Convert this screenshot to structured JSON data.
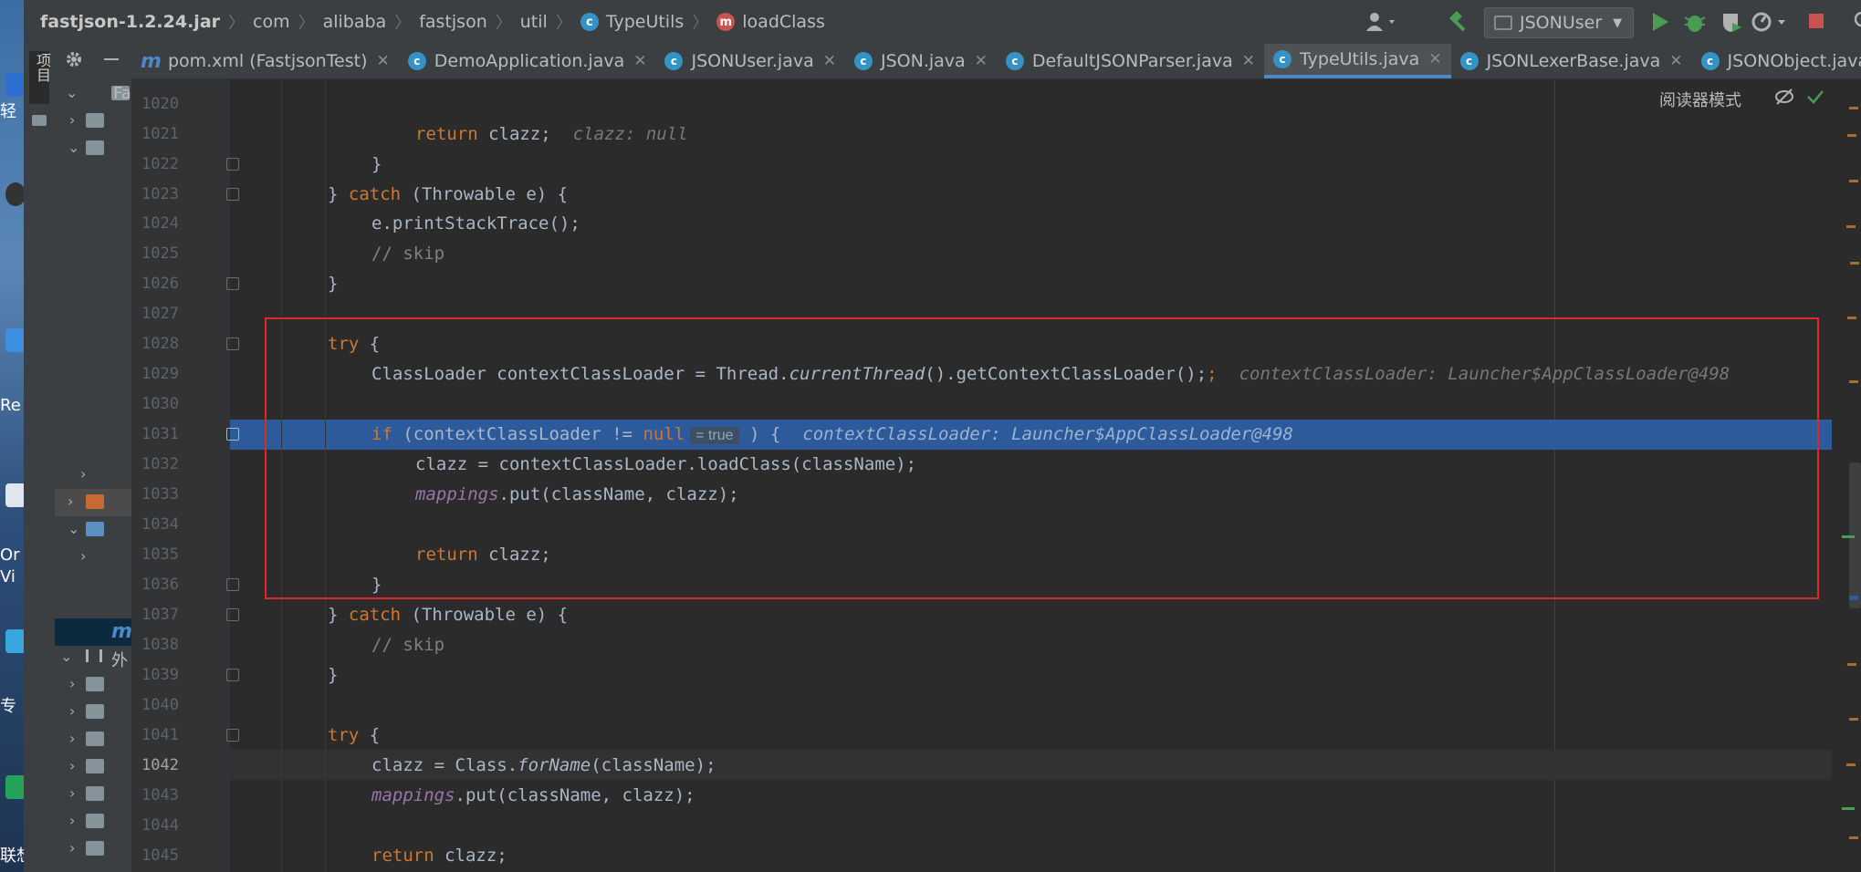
{
  "breadcrumb": {
    "project": "fastjson-1.2.24.jar",
    "parts": [
      "com",
      "alibaba",
      "fastjson",
      "util"
    ],
    "class_name": "TypeUtils",
    "method_name": "loadClass"
  },
  "toolbar": {
    "run_config": "JSONUser",
    "icons": [
      "user-icon",
      "hammer-icon",
      "run-icon",
      "debug-icon",
      "coverage-icon",
      "profile-icon",
      "stop-icon",
      "search-icon"
    ]
  },
  "project_panel": {
    "vertical_label": "项目",
    "labels": [
      "Fa",
      "外"
    ]
  },
  "desktop": {
    "labels": [
      "轻",
      "Re",
      "Or",
      "Vi",
      "专",
      "联想"
    ]
  },
  "tabs": [
    {
      "label": "pom.xml (FastjsonTest)",
      "icon": "maven-icon",
      "active": false
    },
    {
      "label": "DemoApplication.java",
      "icon": "class-icon",
      "active": false
    },
    {
      "label": "JSONUser.java",
      "icon": "class-icon",
      "active": false
    },
    {
      "label": "JSON.java",
      "icon": "class-icon",
      "active": false
    },
    {
      "label": "DefaultJSONParser.java",
      "icon": "class-icon",
      "active": false
    },
    {
      "label": "TypeUtils.java",
      "icon": "class-icon",
      "active": true
    },
    {
      "label": "JSONLexerBase.java",
      "icon": "class-icon",
      "active": false
    },
    {
      "label": "JSONObject.java",
      "icon": "class-icon",
      "active": false
    }
  ],
  "editor": {
    "reader_mode": "阅读器模式",
    "current_line": "1042",
    "highlighted_line": "1031",
    "lines": {
      "l1020": "1020",
      "l1021": "1021",
      "l1022": "1022",
      "l1023": "1023",
      "l1024": "1024",
      "l1025": "1025",
      "l1026": "1026",
      "l1027": "1027",
      "l1028": "1028",
      "l1029": "1029",
      "l1030": "1030",
      "l1031": "1031",
      "l1032": "1032",
      "l1033": "1033",
      "l1034": "1034",
      "l1035": "1035",
      "l1036": "1036",
      "l1037": "1037",
      "l1038": "1038",
      "l1039": "1039",
      "l1040": "1040",
      "l1041": "1041",
      "l1042": "1042",
      "l1043": "1043",
      "l1044": "1044",
      "l1045": "1045"
    },
    "hints": {
      "clazz_null": "clazz: null",
      "ctx_loader": "contextClassLoader: Launcher$AppClassLoader@498",
      "ctx_loader2": "contextClassLoader: Launcher$AppClassLoader@498",
      "inlay_true": "= true"
    },
    "code": {
      "c1021a": "return",
      "c1021b": " clazz;",
      "c1022": "}",
      "c1023a": "} ",
      "c1023b": "catch",
      "c1023c": " (Throwable e) {",
      "c1024": "e.printStackTrace();",
      "c1025": "// skip",
      "c1026": "}",
      "c1028a": "try",
      "c1028b": " {",
      "c1029a": "ClassLoader contextClassLoader = Thread.",
      "c1029b": "currentThread",
      "c1029c": "().getContextClassLoader();",
      "c1031a": "if",
      "c1031b": " (contextClassLoader != ",
      "c1031c": "null",
      "c1031d": " ) {",
      "c1032a": "clazz = contextClassLoader.loadClass(className);",
      "c1033a": "mappings",
      "c1033b": ".put(className, clazz);",
      "c1035a": "return",
      "c1035b": " clazz;",
      "c1036": "}",
      "c1037a": "} ",
      "c1037b": "catch",
      "c1037c": " (Throwable e) {",
      "c1038": "// skip",
      "c1039": "}",
      "c1041a": "try",
      "c1041b": " {",
      "c1042a": "clazz = Class.",
      "c1042b": "forName",
      "c1042c": "(className);",
      "c1043a": "mappings",
      "c1043b": ".put(className, clazz);",
      "c1045a": "return",
      "c1045b": " clazz;"
    }
  }
}
